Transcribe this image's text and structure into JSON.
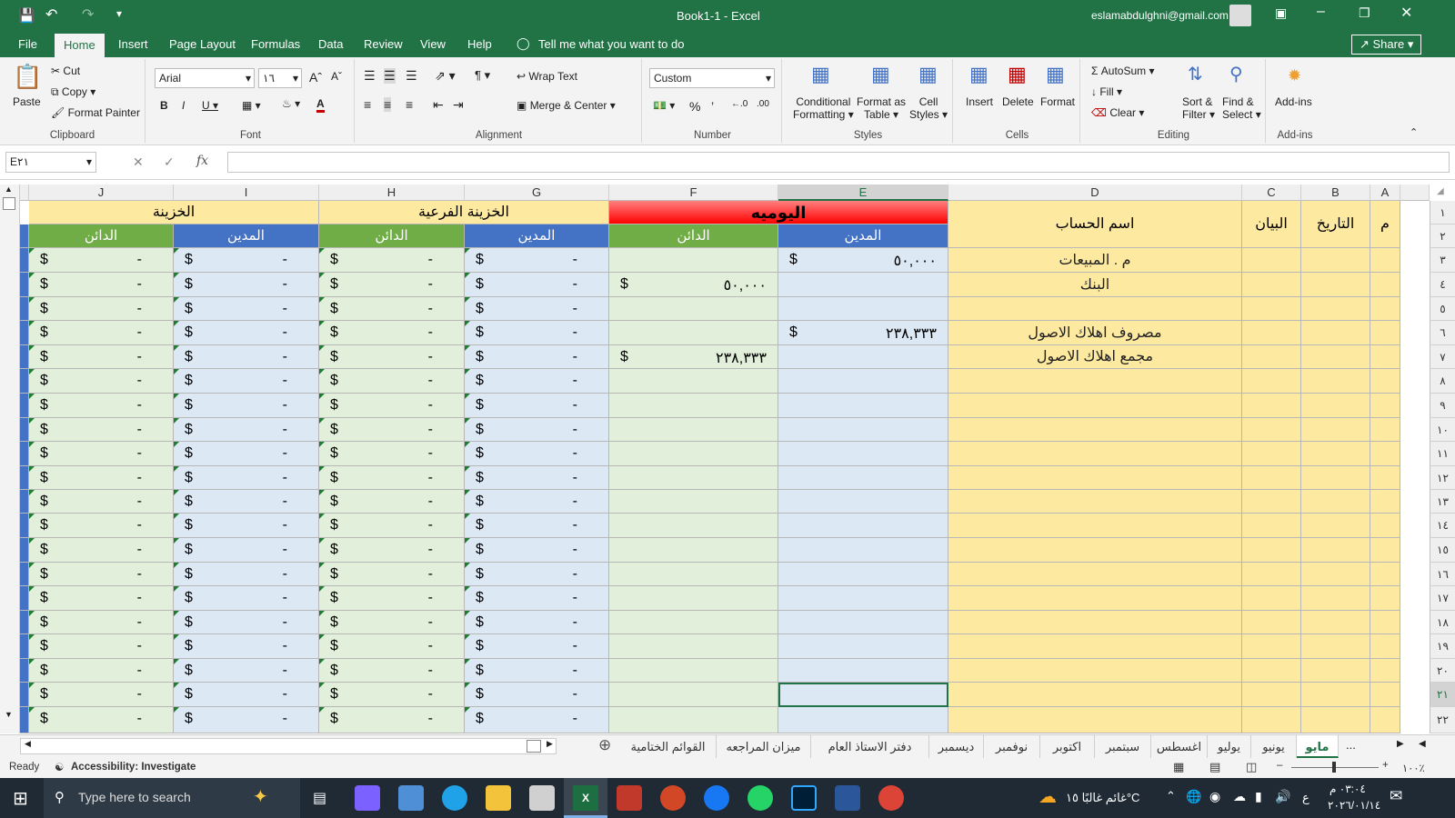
{
  "window": {
    "title": "Book1-1  -  Excel",
    "user": "eslamabdulghni@gmail.com"
  },
  "tabs": [
    "File",
    "Home",
    "Insert",
    "Page Layout",
    "Formulas",
    "Data",
    "Review",
    "View",
    "Help"
  ],
  "tell_me": "Tell me what you want to do",
  "share": "Share",
  "clipboard": {
    "paste": "Paste",
    "cut": "Cut",
    "copy": "Copy",
    "format_painter": "Format Painter",
    "label": "Clipboard"
  },
  "font": {
    "name": "Arial",
    "size": "١٦",
    "label": "Font"
  },
  "alignment": {
    "wrap": "Wrap Text",
    "merge": "Merge & Center",
    "label": "Alignment"
  },
  "number": {
    "format": "Custom",
    "label": "Number"
  },
  "styles": {
    "conditional": "Conditional",
    "formatting": "Formatting",
    "format_as": "Format as",
    "table": "Table",
    "cell": "Cell",
    "styles": "Styles",
    "label": "Styles"
  },
  "cells": {
    "insert": "Insert",
    "delete": "Delete",
    "format": "Format",
    "label": "Cells"
  },
  "editing": {
    "autosum": "AutoSum",
    "fill": "Fill",
    "clear": "Clear",
    "sort": "Sort &",
    "filter": "Filter",
    "find": "Find &",
    "select": "Select",
    "label": "Editing"
  },
  "addins": {
    "btn": "Add-ins",
    "label": "Add-ins"
  },
  "namebox": "E٢١",
  "fx": "fx",
  "columns": [
    "J",
    "I",
    "H",
    "G",
    "F",
    "E",
    "D",
    "C",
    "B",
    "A"
  ],
  "rows": [
    "١",
    "٢",
    "٣",
    "٤",
    "٥",
    "٦",
    "٧",
    "٨",
    "٩",
    "١٠",
    "١١",
    "١٢",
    "١٣",
    "١٤",
    "١٥",
    "١٦",
    "١٧",
    "١٨",
    "١٩",
    "٢٠",
    "٢١",
    "٢٢"
  ],
  "headers": {
    "treasury": "الخزينة",
    "sub_treasury": "الخزينة الفرعية",
    "journal": "اليوميه",
    "account_name": "اسم الحساب",
    "description": "البيان",
    "date": "التاريخ",
    "m": "م",
    "debit": "المدين",
    "credit": "الدائن"
  },
  "entries": [
    {
      "account": "م . المبيعات",
      "debit": "٥٠,٠٠٠",
      "credit": ""
    },
    {
      "account": "البنك",
      "debit": "",
      "credit": "٥٠,٠٠٠"
    },
    {
      "account": "",
      "debit": "",
      "credit": ""
    },
    {
      "account": "مصروف اهلاك الاصول",
      "debit": "٢٣٨,٣٣٣",
      "credit": ""
    },
    {
      "account": "مجمع اهلاك الاصول",
      "debit": "",
      "credit": "٢٣٨,٣٣٣"
    }
  ],
  "acc_symbol": "$",
  "acc_dash": "-",
  "sheets": [
    "مايو",
    "يونيو",
    "يوليو",
    "اغسطس",
    "سبتمبر",
    "اكتوبر",
    "نوفمبر",
    "ديسمبر",
    "دفتر الاستاذ العام",
    "ميزان المراجعه",
    "القوائم الختامية"
  ],
  "ellipsis": "...",
  "status": {
    "ready": "Ready",
    "accessibility": "Accessibility: Investigate",
    "zoom": "١٠٠٪"
  },
  "taskbar": {
    "search": "Type here to search",
    "weather": "غائم غالبًا  ١٥°C",
    "lang": "ع",
    "time": "٠٣:٠٤ م",
    "date": "٢٠٢٦/٠١/١٤"
  },
  "colors": {
    "excel_green": "#217346",
    "header_yellow": "#fde9a0",
    "debit_blue": "#4472c4",
    "credit_green": "#70ad47",
    "red": "#ff0000"
  }
}
